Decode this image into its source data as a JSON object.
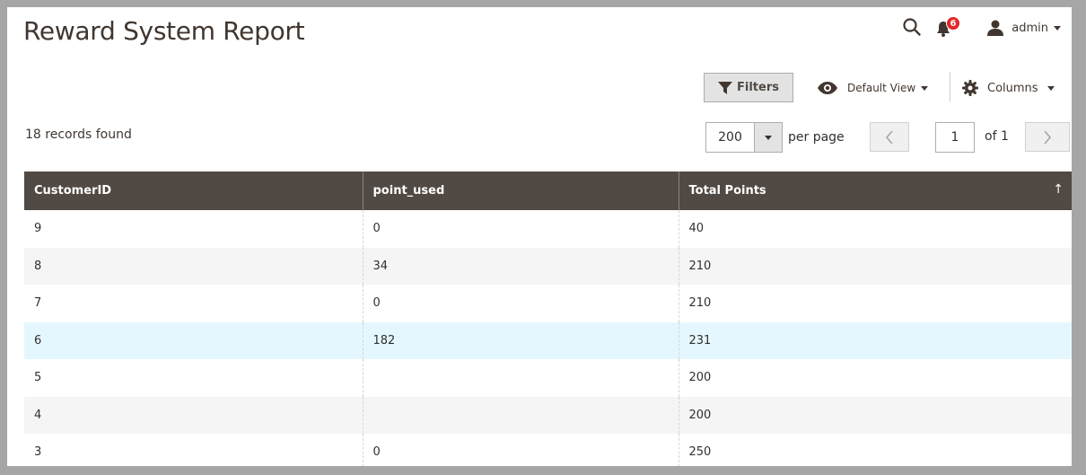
{
  "page": {
    "title": "Reward System Report"
  },
  "header": {
    "notifications_count": "6",
    "user_name": "admin"
  },
  "toolbar": {
    "filters_label": "Filters",
    "view_label": "Default View",
    "columns_label": "Columns"
  },
  "grid_info": {
    "records_found": "18 records found",
    "per_page_value": "200",
    "per_page_label": "per page",
    "current_page": "1",
    "page_total": "of 1"
  },
  "table": {
    "headers": [
      "CustomerID",
      "point_used",
      "Total Points"
    ],
    "sort_indicator": "↑",
    "rows": [
      [
        "9",
        "0",
        "40"
      ],
      [
        "8",
        "34",
        "210"
      ],
      [
        "7",
        "0",
        "210"
      ],
      [
        "6",
        "182",
        "231"
      ],
      [
        "5",
        "",
        "200"
      ],
      [
        "4",
        "",
        "200"
      ],
      [
        "3",
        "0",
        "250"
      ]
    ],
    "highlight_row": 3
  },
  "icons": {
    "search": "search-icon",
    "bell": "bell-icon",
    "user": "user-icon",
    "filter": "filter-icon",
    "eye": "eye-icon",
    "gear": "gear-icon",
    "prev": "chevron-left-icon",
    "next": "chevron-right-icon"
  },
  "colors": {
    "table_header": "#514943",
    "badge": "#e22626",
    "highlight_row": "#e5f7fe"
  }
}
